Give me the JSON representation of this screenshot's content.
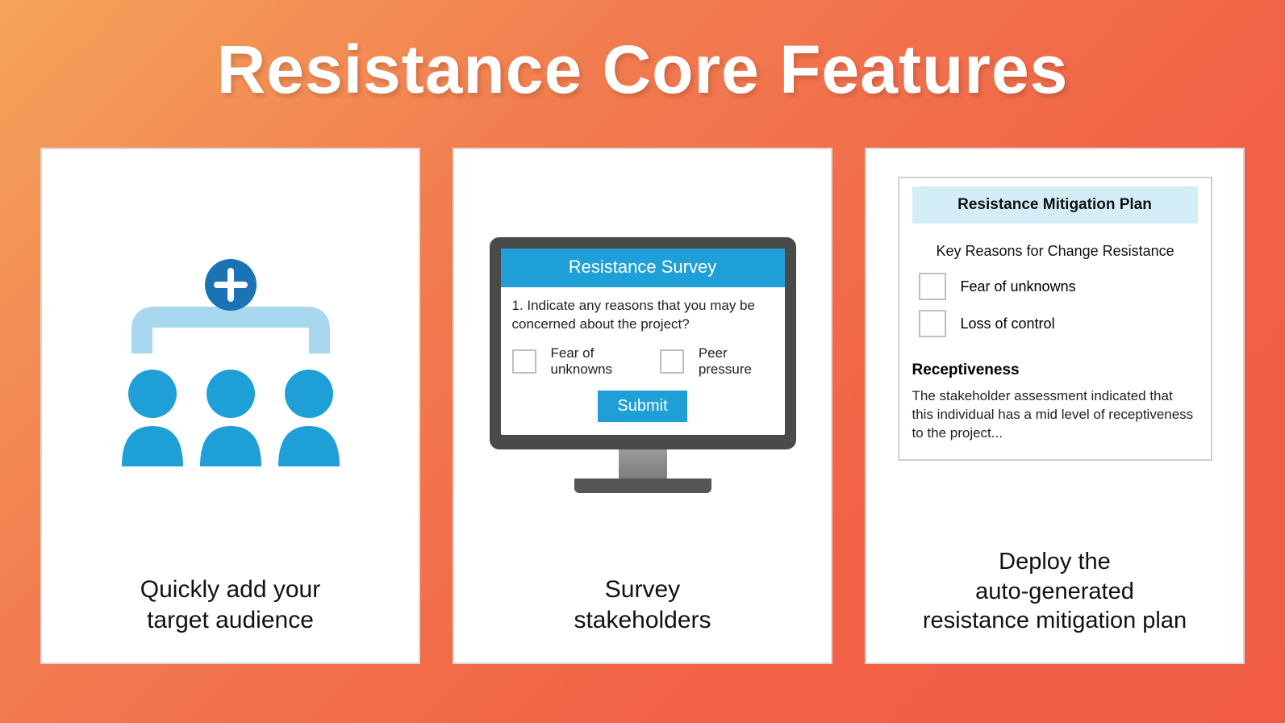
{
  "title": "Resistance Core Features",
  "colors": {
    "accent_blue": "#1f9fd8",
    "badge_blue": "#1b73b5",
    "bg_gradient_from": "#f5a35a",
    "bg_gradient_to": "#f25c45",
    "doc_header_bg": "#d4eef8"
  },
  "card1": {
    "caption_line1": "Quickly add your",
    "caption_line2": "target audience"
  },
  "card2": {
    "survey_title": "Resistance Survey",
    "question": "1. Indicate any reasons that you may be concerned about the project?",
    "options": [
      "Fear of unknowns",
      "Peer pressure"
    ],
    "submit_label": "Submit",
    "caption_line1": "Survey",
    "caption_line2": "stakeholders"
  },
  "card3": {
    "doc_title": "Resistance Mitigation Plan",
    "subheading": "Key Reasons for Change Resistance",
    "reasons": [
      "Fear of unknowns",
      "Loss of control"
    ],
    "section_heading": "Receptiveness",
    "section_body": "The stakeholder assessment indicated that this individual has a mid level of receptiveness to the project...",
    "caption_line1": "Deploy the",
    "caption_line2": "auto-generated",
    "caption_line3": "resistance mitigation plan"
  }
}
